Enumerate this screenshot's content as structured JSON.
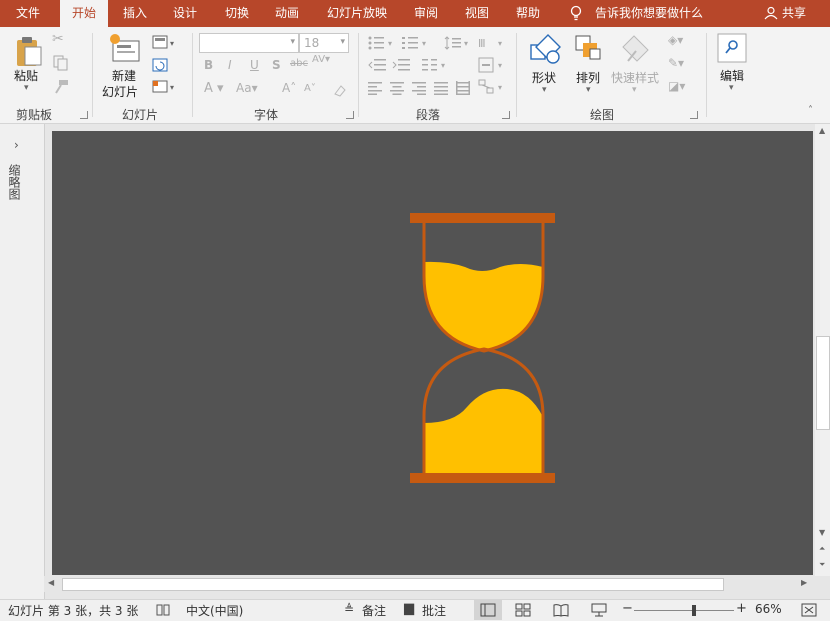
{
  "tabs": [
    "文件",
    "开始",
    "插入",
    "设计",
    "切换",
    "动画",
    "幻灯片放映",
    "审阅",
    "视图",
    "帮助"
  ],
  "tell_me": "告诉我你想要做什么",
  "share": "共享",
  "clipboard": {
    "paste": "粘贴",
    "group": "剪贴板"
  },
  "slides": {
    "new_slide_line1": "新建",
    "new_slide_line2": "幻灯片",
    "group": "幻灯片"
  },
  "font": {
    "name": "",
    "size": "18",
    "group": "字体",
    "bold": "B",
    "italic": "I",
    "underline": "U",
    "shadow": "S",
    "strike": "abc"
  },
  "paragraph": {
    "group": "段落"
  },
  "drawing": {
    "shapes": "形状",
    "arrange": "排列",
    "quick_styles": "快速样式",
    "group": "绘图"
  },
  "editing": {
    "label": "编辑"
  },
  "thumbnails_label": "缩略图",
  "status": {
    "slide_info": "幻灯片 第 3 张，共 3 张",
    "language": "中文(中国)",
    "notes": "备注",
    "comments": "批注",
    "zoom": "66%",
    "zoom_level": 0.6
  },
  "colors": {
    "accent": "#b7472a",
    "canvas": "#535353",
    "frame": "#c55a11",
    "sand": "#ffc000"
  }
}
